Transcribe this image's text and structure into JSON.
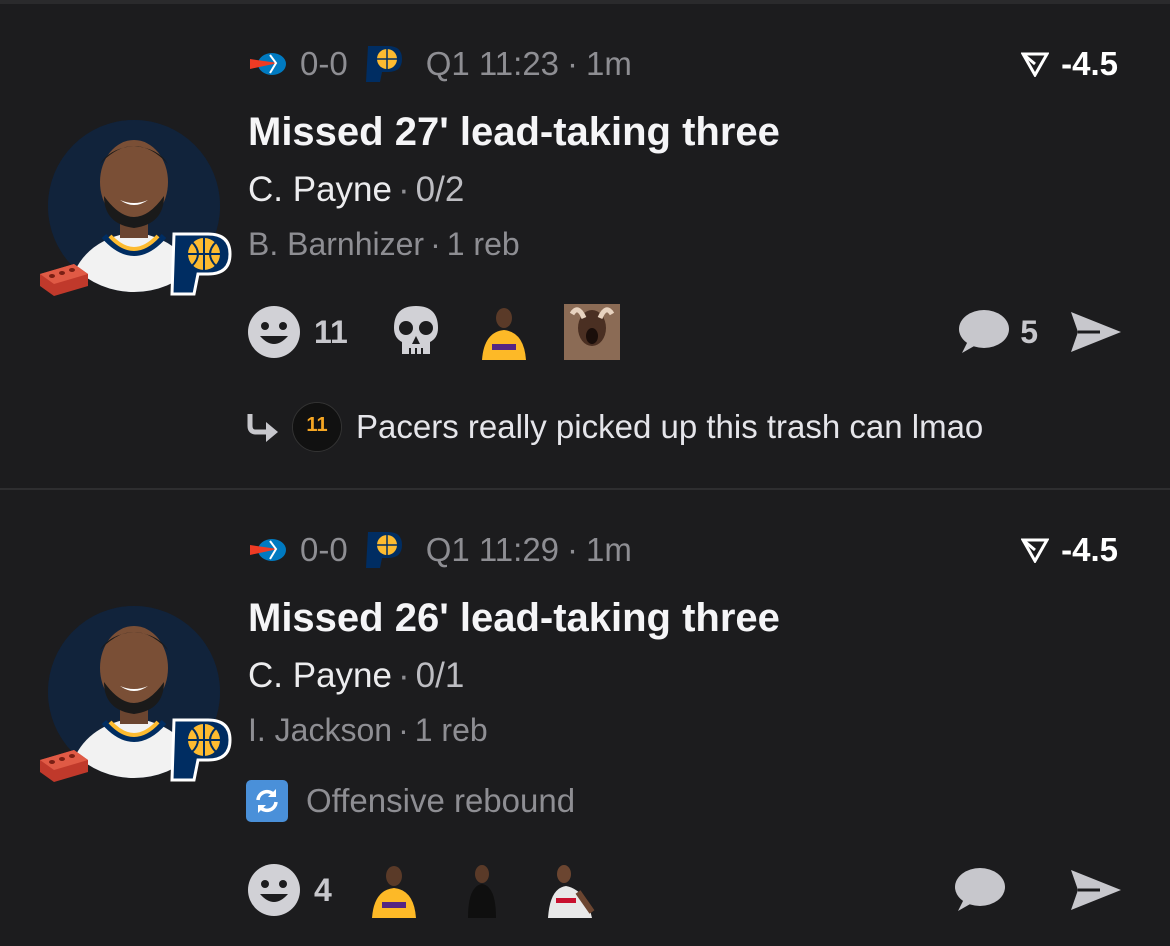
{
  "posts": [
    {
      "score": "0-0",
      "clock": "Q1 11:23",
      "age": "1m",
      "spread": "-4.5",
      "title": "Missed 27' lead-taking three",
      "shooter": "C. Payne",
      "shooter_stat": "0/2",
      "rebounder": "B. Barnhizer",
      "rebound_stat": "1 reb",
      "reaction_count": "11",
      "comment_count": "5",
      "reply_text": "Pacers really picked up this trash can lmao",
      "reply_avatar_text": "11"
    },
    {
      "score": "0-0",
      "clock": "Q1 11:29",
      "age": "1m",
      "spread": "-4.5",
      "title": "Missed 26' lead-taking three",
      "shooter": "C. Payne",
      "shooter_stat": "0/1",
      "rebounder": "I. Jackson",
      "rebound_stat": "1 reb",
      "tag": "Offensive rebound",
      "reaction_count": "4"
    }
  ],
  "separator": "·",
  "colors": {
    "background": "#1c1c1e",
    "muted_text": "#8e8e93",
    "pacers_navy": "#002d62",
    "pacers_gold": "#fdbb30",
    "thunder_blue": "#007ac1",
    "thunder_orange": "#ef3b24",
    "oreb_blue": "#4a90d9"
  },
  "icons": [
    "thunder-logo-icon",
    "pacers-logo-icon",
    "spread-arrow-icon",
    "brick-icon",
    "smiley-icon",
    "skull-icon",
    "comment-icon",
    "send-icon",
    "reply-arrow-icon",
    "refresh-icon"
  ]
}
